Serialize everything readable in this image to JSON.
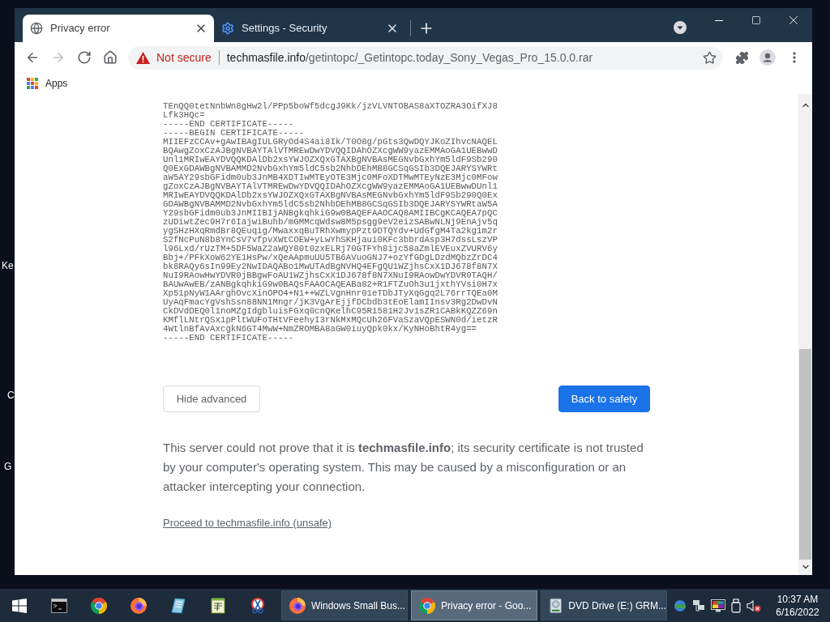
{
  "desktop": {
    "icon_labels": [
      "Ke",
      "C",
      "G"
    ]
  },
  "browser": {
    "tabs": [
      {
        "title": "Privacy error",
        "kind": "page",
        "selected": true
      },
      {
        "title": "Settings - Security",
        "kind": "settings",
        "selected": false
      }
    ],
    "nav_buttons": [
      {
        "kind": "back",
        "disabled": false
      },
      {
        "kind": "forward",
        "disabled": true
      },
      {
        "kind": "reload",
        "disabled": false
      },
      {
        "kind": "home",
        "disabled": false
      }
    ],
    "address_bar": {
      "security_label": "Not secure",
      "host": "techmasfile.info",
      "path": "/getintopc/_Getintopc.today_Sony_Vegas_Pro_15.0.0.rar"
    },
    "bookmarks": [
      {
        "label": "Apps",
        "kind": "apps"
      }
    ],
    "page": {
      "certificate_lines": [
        "TEnQQ0tetNnbWn8gHw2l/PPp5boWf5dcgJ9Kk/jzVLVNTOBAS8aXTOZRA3OifXJ8",
        "Lfk3HQc=",
        "-----END CERTIFICATE-----",
        "-----BEGIN CERTIFICATE-----",
        "MIIEFzCCAv+gAwIBAgIULGRyOd4S4ai8Ik/T0O8g/pGts3QwDQYJKoZIhvcNAQEL",
        "BQAwgZoxCzAJBgNVBAYTAlVTMREwDwYDVQQIDAhOZXcgWW9yazEMMAoGA1UEBwwD",
        "Unl1MRIwEAYDVQQKDAlDb2xsYWJOZXQxGTAXBgNVBAsMEGNvbGxhYm5ldF9Sb290",
        "Q0ExGDAWBgNVBAMMD2NvbGxhYm5ldC5sb2NhbDEhMB8GCSqGSIb3DQEJARYSYWRt",
        "aW5AY29sbGFidm0ub3JnMB4XDTIwMTEyOTE3Mjc0MFoXDTMwMTEyNzE3Mjc0MFow",
        "gZoxCzAJBgNVBAYTAlVTMREwDwYDVQQIDAhOZXcgWW9yazEMMAoGA1UEBwwDUnl1",
        "MRIwEAYDVQQKDAlDb2xsYWJOZXQxGTAXBgNVBAsMEGNvbGxhYm5ldF9Sb290Q0Ex",
        "GDAWBgNVBAMMD2NvbGxhYm5ldC5sb2NhbDEhMB8GCSqGSIb3DQEJARYSYWRtaW5A",
        "Y29sbGFidm0ub3JnMIIBIjANBgkqhkiG9w0BAQEFAAOCAQ8AMIIBCgKCAQEA7pQC",
        "zUDiwtZec9H7r6IajwiBuhb/mGMMcqWdsw8M5psgg9eV2eizSABwNLNj9EnAjv5q",
        "ygSHzHXqRmdBr8QEuqig/MwaxxqBuTRhXwmypPzt9DTQYdv+UdGfgM4Ta2kg1m2r",
        "S2fNcPuN8b8YnCsV7vfpvXWtCOEW+yLwYhSKHjaui0KFc3bbrdAsp3H7dssLszVP",
        "l96Lxd/rUzTM+5DF5WaZ2aWQY80t0zxELRj70GTFYh8ijc58aZmlEVEuxZVURV6y",
        "Bbj+/PFkXoW62YE1HsPw/xQeAApmuUU5TB6AVuoGNJ7+ozYfGDgLDzdMQbzZrDC4",
        "bk8RAQy6sIn99Ey2NwIDAQABo1MwUTAdBgNVHQ4EFgQU1WZjhsCxX1DJ678f8N7X",
        "NuI9RAowHwYDVR0jBBgwFoAU1WZjhsCxX1DJ678f8N7XNuI9RAowDwYDVR0TAQH/",
        "BAUwAwEB/zANBgkqhkiG9w0BAQsFAAOCAQEABa82+R1FTZuOh3u1jxthYVsi0H7x",
        "Xp51pNyW1AArghOvcXinOPO4+N1++WZLVgnHnr01eTDbJTyXqGgq2L76rrTQEa0M",
        "UyAqFmacYgVshSsn88NN1Mngr/jK3VgArEjjfDCbdb3tEoElamIInsv3Rg2DwDvN",
        "CkDVdDEQ0l1noMZgIdgbluisFGxq0cnQKelhC95R1581H2Jv1sZR1CABkKQZZ69n",
        "KMflLNtrQSx1pPltWUFoTHtVFeehyI3rNkMxMQcUh26FVaSzaVQpESWN0d/ietzR",
        "4WtlnBfAvAxcgkN6GT4MwW+NmZROMBA8aGW0iuyQpk0kx/KyNHoBhtR4yg==",
        "-----END CERTIFICATE-----"
      ],
      "buttons": [
        {
          "label": "Hide advanced",
          "kind": "secondary"
        },
        {
          "label": "Back to safety",
          "kind": "primary"
        }
      ],
      "explanation": "This server could not prove that it is **techmasfile.info**; its security certificate is not trusted by your computer's operating system. This may be caused by a misconfiguration or an attacker intercepting your connection.",
      "proceed_link": "Proceed to techmasfile.info (unsafe)"
    }
  },
  "taskbar": {
    "pinned": [
      {
        "kind": "terminal"
      },
      {
        "kind": "chrome"
      },
      {
        "kind": "firefox"
      },
      {
        "kind": "document"
      },
      {
        "kind": "notepad"
      },
      {
        "kind": "snip"
      }
    ],
    "windows": [
      {
        "label": "Windows Small Bus...",
        "kind": "firefox",
        "selected": false
      },
      {
        "label": "Privacy error - Goo...",
        "kind": "chrome",
        "selected": true
      },
      {
        "label": "DVD Drive (E:) GRM...",
        "kind": "drive",
        "selected": false
      }
    ],
    "tray": {
      "volume_muted": true,
      "time": "10:37 AM",
      "date": "6/16/2022"
    }
  }
}
